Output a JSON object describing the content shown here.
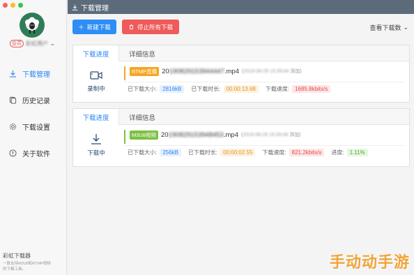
{
  "window": {
    "title": "下载管理"
  },
  "sidebar": {
    "vip_badge": "会员",
    "username": "彩虹用户",
    "items": [
      {
        "label": "下载管理",
        "icon": "download-icon",
        "active": true
      },
      {
        "label": "历史记录",
        "icon": "history-icon",
        "active": false
      },
      {
        "label": "下载设置",
        "icon": "gear-icon",
        "active": false
      },
      {
        "label": "关于软件",
        "icon": "info-icon",
        "active": false
      }
    ],
    "footer": {
      "app_name": "彩虹下载器",
      "desc_line1": "一款支持M3U8和RTMP视频",
      "desc_line2": "的下载工具。"
    }
  },
  "toolbar": {
    "new_label": "新建下载",
    "stop_label": "停止所有下载",
    "view_count_label": "查看下载数"
  },
  "tasks": [
    {
      "tab_progress": "下载进度",
      "tab_detail": "详细信息",
      "status": "录制中",
      "status_icon": "camera-icon",
      "protocol": "RTMP直播",
      "filename_prefix": "20",
      "filename_blurred": "190829153944447",
      "filename_ext": ".mp4",
      "added_open": "(",
      "added_time": "2019-08-29 15:39:44",
      "added_label": "添加)",
      "size_label": "已下载大小:",
      "size": "2816kB",
      "duration_label": "已下载时长:",
      "duration": "00:00:13.68",
      "speed_label": "下载速度:",
      "speed": "1685.8kbits/s"
    },
    {
      "tab_progress": "下载进度",
      "tab_detail": "详细信息",
      "status": "下载中",
      "status_icon": "download-arrow-icon",
      "protocol": "M3U8视频",
      "filename_prefix": "20",
      "filename_blurred": "190829153948453",
      "filename_ext": ".mp4",
      "added_open": "(",
      "added_time": "2019-08-29 15:39:48",
      "added_label": "添加)",
      "size_label": "已下载大小:",
      "size": "256kB",
      "duration_label": "已下载时长:",
      "duration": "00:00:02.55",
      "speed_label": "下载速度:",
      "speed": "821.2kbits/s",
      "progress_label": "进度:",
      "progress": "1.11%"
    }
  ],
  "watermark": "手动动手游",
  "colors": {
    "accent": "#2c85f3",
    "header": "#5b6b7a",
    "stop": "#ef5a5a",
    "new": "#2c8ef6"
  }
}
